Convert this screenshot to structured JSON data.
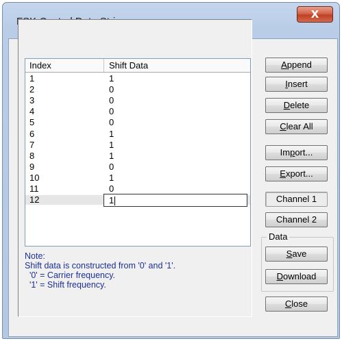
{
  "window": {
    "title": "FSK Control Data String",
    "close_glyph": "X"
  },
  "list": {
    "columns": [
      "Index",
      "Shift Data"
    ],
    "rows": [
      {
        "index": "1",
        "value": "1"
      },
      {
        "index": "2",
        "value": "0"
      },
      {
        "index": "3",
        "value": "0"
      },
      {
        "index": "4",
        "value": "0"
      },
      {
        "index": "5",
        "value": "0"
      },
      {
        "index": "6",
        "value": "1"
      },
      {
        "index": "7",
        "value": "1"
      },
      {
        "index": "8",
        "value": "1"
      },
      {
        "index": "9",
        "value": "0"
      },
      {
        "index": "10",
        "value": "1"
      },
      {
        "index": "11",
        "value": "0"
      },
      {
        "index": "12",
        "value": "1"
      }
    ],
    "editing_row_index": "12",
    "editing_value": "1"
  },
  "note": {
    "lines": [
      "Note:",
      "Shift data is constructed from '0' and '1'.",
      "  '0' = Carrier frequency.",
      "  '1' = Shift frequency."
    ]
  },
  "buttons": {
    "append": "Append",
    "insert": "Insert",
    "delete": "Delete",
    "clear_all": "Clear All",
    "import": "Import...",
    "export": "Export...",
    "channel1": "Channel 1",
    "channel2": "Channel 2",
    "save": "Save",
    "download": "Download",
    "close": "Close"
  },
  "data_group": {
    "label": "Data"
  },
  "state": {
    "selected_channel": "Channel 1"
  },
  "colors": {
    "note_text": "#1c2f96",
    "close_button": "#c7472b"
  }
}
